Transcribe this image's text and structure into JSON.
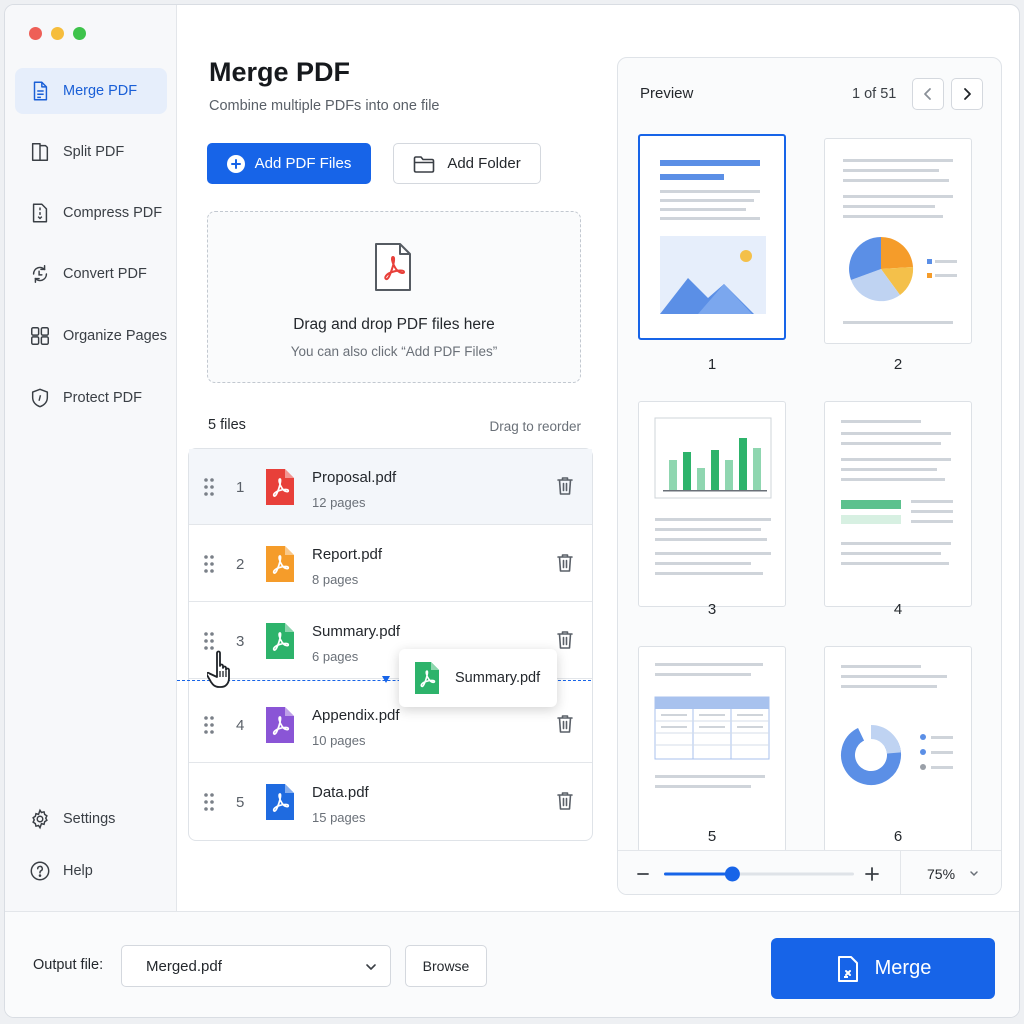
{
  "window": {
    "traffic_colors": [
      "#ee5f57",
      "#f6bd3c",
      "#3ec34b"
    ]
  },
  "sidebar": {
    "items": [
      {
        "label": "Merge PDF",
        "icon": "merge-pdf-icon",
        "active": true
      },
      {
        "label": "Split PDF",
        "icon": "split-pdf-icon"
      },
      {
        "label": "Compress PDF",
        "icon": "compress-pdf-icon"
      },
      {
        "label": "Convert PDF",
        "icon": "convert-pdf-icon"
      },
      {
        "label": "Organize Pages",
        "icon": "organize-pages-icon"
      },
      {
        "label": "Protect PDF",
        "icon": "shield-icon"
      }
    ],
    "bottom": [
      {
        "label": "Settings",
        "icon": "gear-icon"
      },
      {
        "label": "Help",
        "icon": "help-icon"
      }
    ]
  },
  "main": {
    "title": "Merge PDF",
    "subtitle": "Combine multiple PDFs into one file",
    "add_files_label": "Add PDF Files",
    "add_folder_label": "Add Folder",
    "dropzone": {
      "title": "Drag and drop PDF files here",
      "subtitle": "You can also click “Add PDF Files”"
    },
    "files_count": "5 files",
    "drag_hint": "Drag to reorder",
    "files": [
      {
        "num": "1",
        "name": "Proposal.pdf",
        "pages": "12 pages",
        "color": "#e8403a"
      },
      {
        "num": "2",
        "name": "Report.pdf",
        "pages": "8 pages",
        "color": "#f59c2a"
      },
      {
        "num": "3",
        "name": "Summary.pdf",
        "pages": "6 pages",
        "color": "#2db36b"
      },
      {
        "num": "4",
        "name": "Appendix.pdf",
        "pages": "10 pages",
        "color": "#8a55d6"
      },
      {
        "num": "5",
        "name": "Data.pdf",
        "pages": "15 pages",
        "color": "#1f6be0"
      }
    ],
    "drag_ghost_label": "Summary.pdf"
  },
  "preview": {
    "title": "Preview",
    "page_counter": "1 of 51",
    "thumb_labels": [
      "1",
      "2",
      "3",
      "4",
      "5",
      "6"
    ],
    "selected_thumb": "1",
    "zoom_level": "75%",
    "zoom_fraction": 0.36
  },
  "footer": {
    "output_label": "Output file:",
    "output_value": "Merged.pdf",
    "browse_label": "Browse",
    "merge_label": "Merge"
  },
  "colors": {
    "accent": "#1764e8",
    "active_nav_bg": "#e6eefb"
  }
}
